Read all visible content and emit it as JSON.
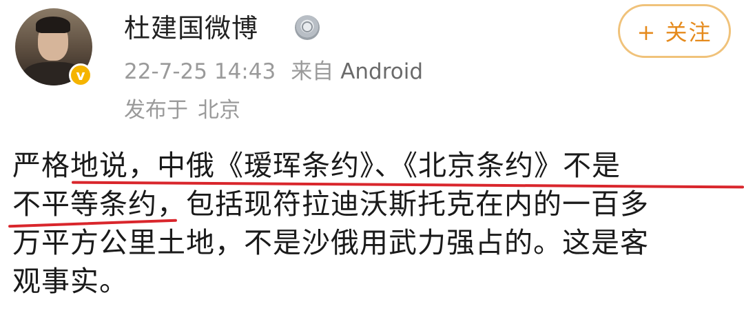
{
  "post": {
    "username": "杜建国微博",
    "timestamp": "22-7-25 14:43",
    "source_label": "来自",
    "source_name": "Android",
    "location_label": "发布于",
    "location_city": "北京",
    "follow_label": "+ 关注",
    "verified_badge": "v",
    "medal_icon": "medal-icon",
    "accent_color": "#e58a1c",
    "badge_color": "#f5b400",
    "highlight_color": "#d9262c"
  },
  "content": {
    "lines": [
      "严格地说，中俄《瑷珲条约》、《北京条约》不是",
      "不平等条约，包括现符拉迪沃斯托克在内的一百多",
      "万平方公里土地，不是沙俄用武力强占的。这是客",
      "观事实。"
    ]
  }
}
